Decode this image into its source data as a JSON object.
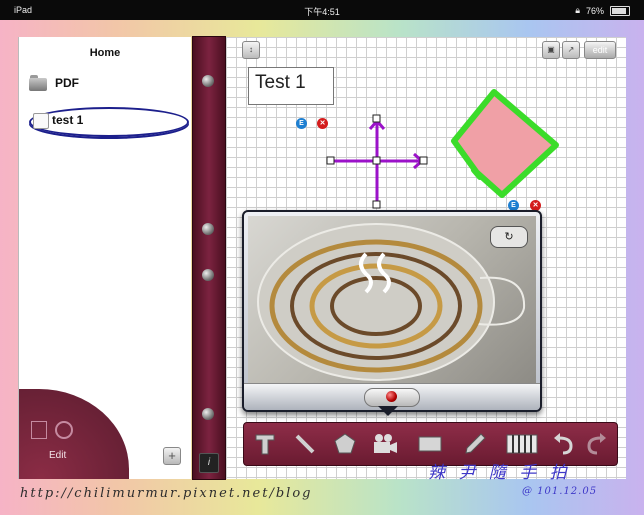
{
  "status_bar": {
    "device": "iPad",
    "time": "下午4:51",
    "battery": "76%",
    "battery_level": 0.76
  },
  "sidebar": {
    "title": "Home",
    "items": [
      {
        "label": "PDF",
        "icon": "folder-icon"
      },
      {
        "label": "test 1",
        "icon": "note-icon",
        "selected": true
      }
    ],
    "edit_label": "Edit",
    "add_label": "+"
  },
  "spine": {
    "info_label": "i"
  },
  "canvas": {
    "text_box": "Test 1",
    "edit_button": "edit",
    "badge_edit": "E",
    "badge_delete": "✕",
    "shape_fill": "#f0a0a6",
    "shape_stroke": "#3bdc2a",
    "arrow_color": "#9b12c9"
  },
  "camera": {
    "switch_icon": "camera-switch-icon",
    "record_icon": "record-icon"
  },
  "toolbar": {
    "tools": [
      "text-tool-icon",
      "line-tool-icon",
      "pentagon-tool-icon",
      "video-camera-icon",
      "rectangle-tool-icon",
      "pen-tool-icon",
      "keyboard-icon",
      "undo-icon",
      "redo-icon"
    ]
  },
  "watermark": {
    "url": "http://chilimurmur.pixnet.net/blog",
    "signature": "辣 尹 隨 手 拍",
    "date": "@ 101.12.05"
  },
  "colors": {
    "leather": "#7c2340",
    "accent_blue": "#1c1f8c"
  }
}
